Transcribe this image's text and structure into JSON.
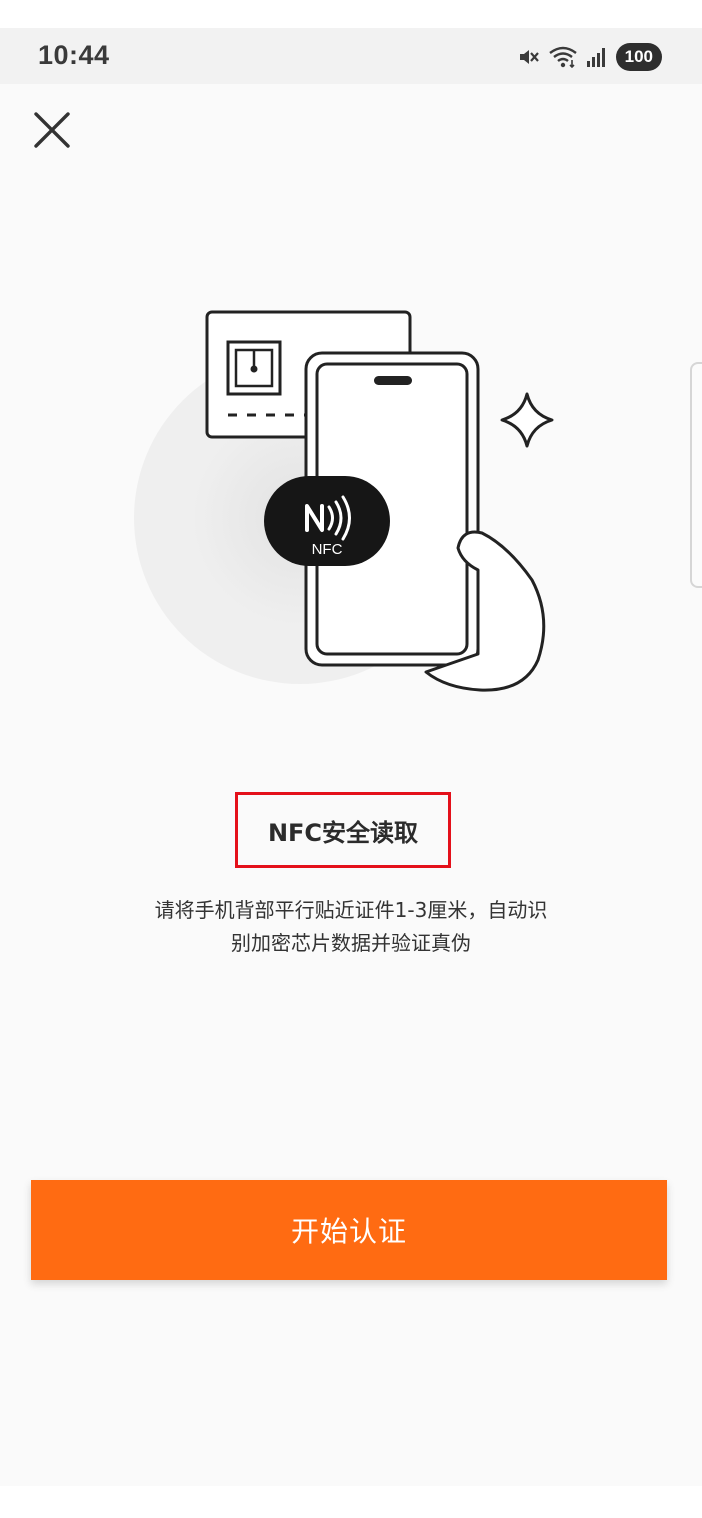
{
  "status_bar": {
    "time": "10:44",
    "battery": "100",
    "icons": [
      "mute-icon",
      "wifi-icon",
      "signal-icon",
      "battery-icon"
    ]
  },
  "header": {
    "close_icon": "close-icon"
  },
  "illustration": {
    "nfc_label": "NFC",
    "icons": [
      "id-card-icon",
      "phone-icon",
      "hand-icon",
      "sparkle-icon",
      "nfc-badge-icon"
    ]
  },
  "main": {
    "title": "NFC安全读取",
    "description_line1": "请将手机背部平行贴近证件1-3厘米，自动识",
    "description_line2": "别加密芯片数据并验证真伪"
  },
  "actions": {
    "start_label": "开始认证"
  },
  "colors": {
    "accent": "#ff6b12",
    "highlight_border": "#e4101a",
    "text": "#2b2b2b"
  }
}
